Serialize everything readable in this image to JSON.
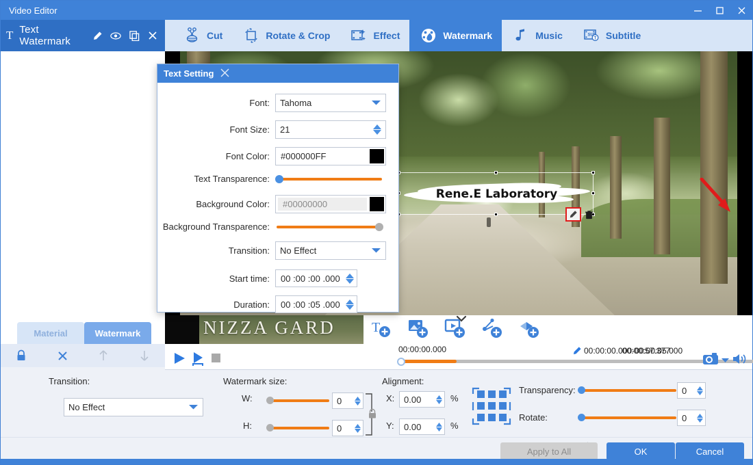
{
  "window": {
    "title": "Video Editor",
    "minimize_label": "minimize",
    "maximize_label": "maximize",
    "close_label": "close"
  },
  "left_header": {
    "icon": "text-icon",
    "title": "Text Watermark",
    "actions": [
      "edit-icon",
      "eye-icon",
      "copy-icon",
      "close-icon"
    ]
  },
  "tabs": [
    {
      "label": "Cut",
      "icon": "scissors-icon",
      "active": false
    },
    {
      "label": "Rotate & Crop",
      "icon": "rotate-crop-icon",
      "active": false
    },
    {
      "label": "Effect",
      "icon": "effect-icon",
      "active": false
    },
    {
      "label": "Watermark",
      "icon": "watermark-icon",
      "active": true
    },
    {
      "label": "Music",
      "icon": "music-note-icon",
      "active": false
    },
    {
      "label": "Subtitle",
      "icon": "subtitle-icon",
      "active": false
    }
  ],
  "left_panel": {
    "tabs": [
      {
        "label": "Material",
        "active": false
      },
      {
        "label": "Watermark",
        "active": true
      }
    ],
    "tools": [
      "lock-icon",
      "delete-icon",
      "move-up-icon",
      "move-down-icon"
    ]
  },
  "dialog": {
    "title": "Text Setting",
    "close_label": "close-dialog",
    "fields": {
      "font_label": "Font:",
      "font_value": "Tahoma",
      "font_size_label": "Font Size:",
      "font_size_value": "21",
      "font_color_label": "Font Color:",
      "font_color_value": "#000000FF",
      "font_color_swatch": "#000000",
      "text_transparence_label": "Text Transparence:",
      "text_transparence_value": 0,
      "background_color_label": "Background Color:",
      "background_color_value": "#00000000",
      "background_color_swatch": "#000000",
      "background_transparence_label": "Background Transparence:",
      "background_transparence_value": 100,
      "transition_label": "Transition:",
      "transition_value": "No Effect",
      "start_time_label": "Start time:",
      "start_time_value": "00 :00 :00 .000",
      "duration_label": "Duration:",
      "duration_value": "00 :00 :05 .000"
    }
  },
  "preview": {
    "watermark_text": "Rene.E Laboratory",
    "edit_tool": "edit-watermark-icon",
    "delete_tool": "delete-watermark-icon"
  },
  "filmstrip": {
    "thumb_text": "NIZZA GARD",
    "add_buttons": [
      "add-text-icon",
      "add-image-icon",
      "add-video-icon",
      "add-effect-icon",
      "add-layer-icon"
    ],
    "collapse": "chevron-down-icon"
  },
  "player": {
    "play": "play-icon",
    "play_selection": "play-selection-icon",
    "stop": "stop-icon",
    "current_time": "00:00:00.000",
    "clip_range": "00:00:00.000-00:00:05.000",
    "clip_edit_icon": "pencil-icon",
    "total_time": "00:00:57.377",
    "snapshot": "camera-icon",
    "snapshot_caret": "caret-down-icon",
    "volume": "volume-icon",
    "progress_percent": 12
  },
  "settings": {
    "transition_label": "Transition:",
    "transition_value": "No Effect",
    "watermark_size_label": "Watermark size:",
    "w_label": "W:",
    "w_value": "0",
    "h_label": "H:",
    "h_value": "0",
    "lock_ratio_icon": "lock-icon",
    "alignment_label": "Alignment:",
    "x_label": "X:",
    "x_value": "0.00",
    "x_unit": "%",
    "y_label": "Y:",
    "y_value": "0.00",
    "y_unit": "%",
    "align_grid_icon": "alignment-grid-icon",
    "transparency_label": "Transparency:",
    "transparency_value": "0",
    "rotate_label": "Rotate:",
    "rotate_value": "0"
  },
  "buttons": {
    "apply_to_all": "Apply to All",
    "ok": "OK",
    "cancel": "Cancel"
  },
  "colors": {
    "accent_blue": "#3f82d8",
    "header_blue": "#2f6fc4",
    "tabbar_blue": "#d7e5f7",
    "slider_orange": "#f07c15"
  }
}
